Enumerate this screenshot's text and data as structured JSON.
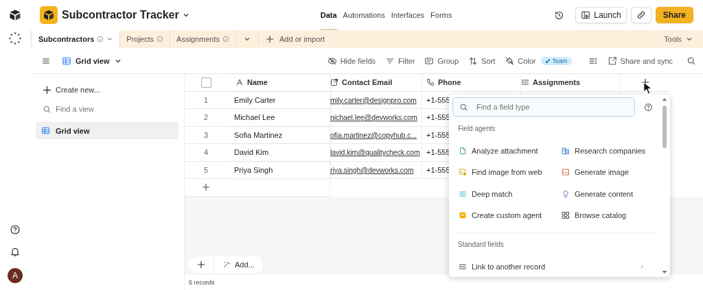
{
  "app": {
    "title": "Subcontractor Tracker"
  },
  "nav": [
    {
      "label": "Data",
      "selected": true
    },
    {
      "label": "Automations",
      "selected": false
    },
    {
      "label": "Interfaces",
      "selected": false
    },
    {
      "label": "Forms",
      "selected": false
    }
  ],
  "actions": {
    "launch": "Launch",
    "share": "Share"
  },
  "tables": [
    {
      "label": "Subcontractors",
      "selected": true
    },
    {
      "label": "Projects",
      "selected": false
    },
    {
      "label": "Assignments",
      "selected": false
    }
  ],
  "add_import": "Add or import",
  "tools": "Tools",
  "view": {
    "name": "Grid view"
  },
  "toolbar": [
    {
      "label": "Hide fields",
      "kind": "eye"
    },
    {
      "label": "Filter",
      "kind": "filter"
    },
    {
      "label": "Group",
      "kind": "group"
    },
    {
      "label": "Sort",
      "kind": "sort"
    },
    {
      "label": "Color",
      "kind": "color",
      "badge": "Team"
    }
  ],
  "share_sync": "Share and sync",
  "sidebar": {
    "create": "Create new...",
    "search_placeholder": "Find a view",
    "items": [
      {
        "label": "Grid view",
        "selected": true
      }
    ]
  },
  "grid": {
    "select_all": {
      "checked": false
    },
    "columns": [
      {
        "label": "Name",
        "kind": "text"
      },
      {
        "label": "Contact Email",
        "kind": "email"
      },
      {
        "label": "Phone",
        "kind": "phone"
      },
      {
        "label": "Assignments",
        "kind": "link"
      }
    ],
    "rows": [
      {
        "number": "1",
        "name": "Emily Carter",
        "email": "mily.carter@designpro.com",
        "phone": "+1-555"
      },
      {
        "number": "2",
        "name": "Michael Lee",
        "email": "nichael.lee@devworks.com",
        "phone": "+1-555"
      },
      {
        "number": "3",
        "name": "Sofia Martinez",
        "email": "ofia.martinez@copyhub.c...",
        "phone": "+1-555"
      },
      {
        "number": "4",
        "name": "David Kim",
        "email": "lavid.kim@qualitycheck.com",
        "phone": "+1-555"
      },
      {
        "number": "5",
        "name": "Priya Singh",
        "email": "riya.singh@devworks.com",
        "phone": "+1-555"
      }
    ]
  },
  "footer": {
    "add": "Add...",
    "count": "5 records"
  },
  "field_menu": {
    "search_placeholder": "Find a field type",
    "sections": [
      {
        "title": "Field agents",
        "kind": "grid",
        "items": [
          {
            "label": "Analyze attachment",
            "kind": "doc"
          },
          {
            "label": "Research companies",
            "kind": "building"
          },
          {
            "label": "Find image from web",
            "kind": "imgsearch"
          },
          {
            "label": "Generate image",
            "kind": "image"
          },
          {
            "label": "Deep match",
            "kind": "match"
          },
          {
            "label": "Generate content",
            "kind": "bulb"
          },
          {
            "label": "Create custom agent",
            "kind": "agent"
          },
          {
            "label": "Browse catalog",
            "kind": "catalog"
          }
        ]
      },
      {
        "title": "Standard fields",
        "kind": "list",
        "items": [
          {
            "label": "Link to another record",
            "kind": "linkrec"
          }
        ]
      }
    ]
  },
  "user": {
    "initial": "A"
  }
}
